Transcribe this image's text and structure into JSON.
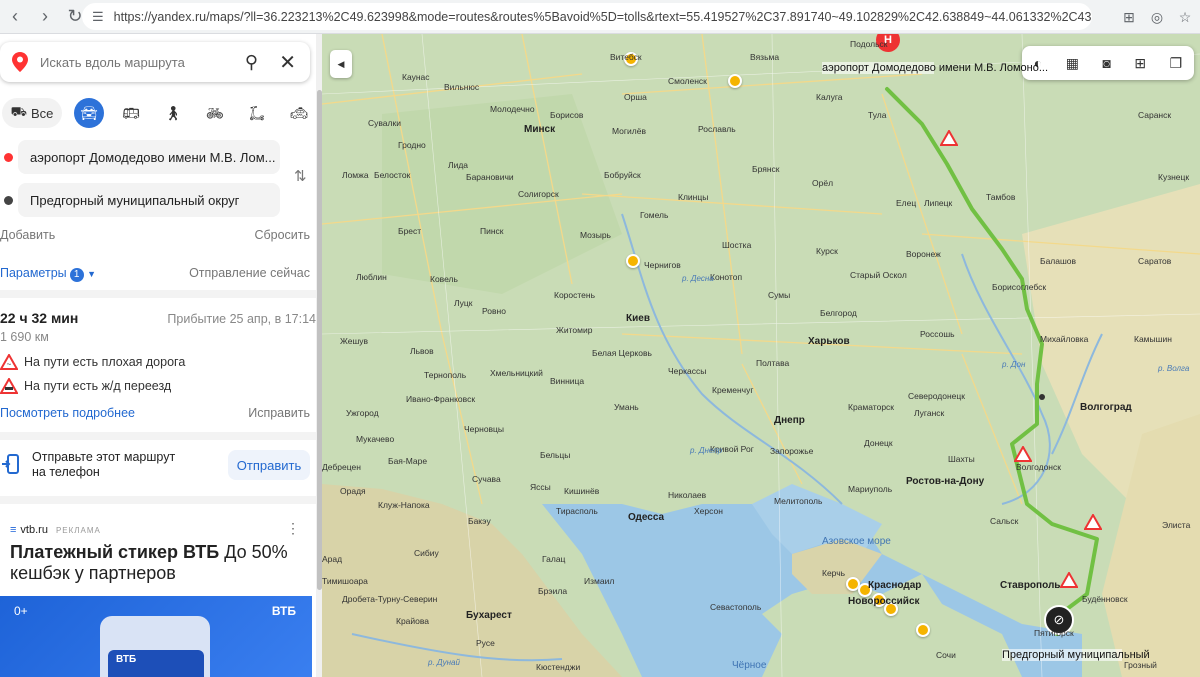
{
  "browser": {
    "url": "https://yandex.ru/maps/?ll=36.223213%2C49.623998&mode=routes&routes%5Bavoid%5D=tolls&rtext=55.419527%2C37.891740~49.102829%2C42.638849~44.061332%2C43.15..."
  },
  "search": {
    "placeholder": "Искать вдоль маршрута"
  },
  "modes": {
    "all_label": "Все"
  },
  "route": {
    "from": "аэропорт Домодедово имени М.В. Лом...",
    "to": "Предгорный муниципальный округ",
    "add_label": "Добавить",
    "reset_label": "Сбросить",
    "params_label": "Параметры",
    "params_count": "1",
    "departure_label": "Отправление сейчас",
    "duration": "22 ч 32 мин",
    "arrival": "Прибытие 25 апр, в 17:14",
    "distance": "1 690 км",
    "warnings": [
      "На пути есть плохая дорога",
      "На пути есть ж/д переезд"
    ],
    "details_label": "Посмотреть подробнее",
    "edit_label": "Исправить"
  },
  "send": {
    "text": "Отправьте этот маршрут на телефон",
    "button_label": "Отправить"
  },
  "ad": {
    "source": "vtb.ru",
    "tag": "РЕКЛАМА",
    "title_bold": "Платежный стикер ВТБ",
    "title_rest": " До 50% кешбэк у партнеров",
    "banner_left": "0+",
    "banner_brand": "ВТБ",
    "card_text": "ВТБ"
  },
  "map": {
    "start_label": "аэропорт Домодедово имени М.В. Ломоно...",
    "end_label": "Предгорный муниципальный",
    "sea_label": "Азовское море",
    "start_marker": "H",
    "cities": [
      {
        "name": "Вязьма"
      },
      {
        "name": "Витебск"
      },
      {
        "name": "Смоленск"
      },
      {
        "name": "Калуга"
      },
      {
        "name": "Подольск"
      },
      {
        "name": "Каунас"
      },
      {
        "name": "Вильнюс"
      },
      {
        "name": "Орша"
      },
      {
        "name": "Молодечно"
      },
      {
        "name": "Борисов"
      },
      {
        "name": "Минск"
      },
      {
        "name": "Могилёв"
      },
      {
        "name": "Рославль"
      },
      {
        "name": "Тула"
      },
      {
        "name": "Саранск"
      },
      {
        "name": "Сувалки"
      },
      {
        "name": "Гродно"
      },
      {
        "name": "Брянск"
      },
      {
        "name": "Бобруйск"
      },
      {
        "name": "Лида"
      },
      {
        "name": "Ломжа"
      },
      {
        "name": "Белосток"
      },
      {
        "name": "Барановичи"
      },
      {
        "name": "Орёл"
      },
      {
        "name": "Кузнецк"
      },
      {
        "name": "Солигорск"
      },
      {
        "name": "Клинцы"
      },
      {
        "name": "Елец"
      },
      {
        "name": "Липецк"
      },
      {
        "name": "Тамбов"
      },
      {
        "name": "Брест"
      },
      {
        "name": "Пинск"
      },
      {
        "name": "Гомель"
      },
      {
        "name": "Мозырь"
      },
      {
        "name": "Шостка"
      },
      {
        "name": "Курск"
      },
      {
        "name": "Воронеж"
      },
      {
        "name": "Балашов"
      },
      {
        "name": "Саратов"
      },
      {
        "name": "Чернигов"
      },
      {
        "name": "Конотоп"
      },
      {
        "name": "Старый Оскол"
      },
      {
        "name": "Люблин"
      },
      {
        "name": "Ковель"
      },
      {
        "name": "Борисоглебск"
      },
      {
        "name": "Коростень"
      },
      {
        "name": "Сумы"
      },
      {
        "name": "Луцк"
      },
      {
        "name": "Ровно"
      },
      {
        "name": "Белгород"
      },
      {
        "name": "Житомир"
      },
      {
        "name": "Киев"
      },
      {
        "name": "Россошь"
      },
      {
        "name": "Михайловка"
      },
      {
        "name": "Камышин"
      },
      {
        "name": "Жешув"
      },
      {
        "name": "Львов"
      },
      {
        "name": "Белая Церковь"
      },
      {
        "name": "Харьков"
      },
      {
        "name": "Полтава"
      },
      {
        "name": "Тернополь"
      },
      {
        "name": "Хмельницкий"
      },
      {
        "name": "Черкассы"
      },
      {
        "name": "Винница"
      },
      {
        "name": "Кременчуг"
      },
      {
        "name": "Северодонецк"
      },
      {
        "name": "Ивано-Франковск"
      },
      {
        "name": "Умань"
      },
      {
        "name": "Краматорск"
      },
      {
        "name": "Луганск"
      },
      {
        "name": "Волгоград"
      },
      {
        "name": "Ужгород"
      },
      {
        "name": "Днепр"
      },
      {
        "name": "Мукачево"
      },
      {
        "name": "Черновцы"
      },
      {
        "name": "Кривой Рог"
      },
      {
        "name": "Запорожье"
      },
      {
        "name": "Донецк"
      },
      {
        "name": "Бая-Маре"
      },
      {
        "name": "Бельцы"
      },
      {
        "name": "Шахты"
      },
      {
        "name": "Волгодонск"
      },
      {
        "name": "Дебрецен"
      },
      {
        "name": "Сучава"
      },
      {
        "name": "Яссы"
      },
      {
        "name": "Мариуполь"
      },
      {
        "name": "Ростов-на-Дону"
      },
      {
        "name": "Орадя"
      },
      {
        "name": "Кишинёв"
      },
      {
        "name": "Николаев"
      },
      {
        "name": "Мелитополь"
      },
      {
        "name": "Клуж-Напока"
      },
      {
        "name": "Тирасполь"
      },
      {
        "name": "Одесса"
      },
      {
        "name": "Херсон"
      },
      {
        "name": "Сальск"
      },
      {
        "name": "Элиста"
      },
      {
        "name": "Бакэу"
      },
      {
        "name": "Сибиу"
      },
      {
        "name": "Галац"
      },
      {
        "name": "Керчь"
      },
      {
        "name": "Новороссийск"
      },
      {
        "name": "Краснодар"
      },
      {
        "name": "Ставрополь"
      },
      {
        "name": "Будённовск"
      },
      {
        "name": "Брэила"
      },
      {
        "name": "Измаил"
      },
      {
        "name": "Бухарест"
      },
      {
        "name": "Севастополь"
      },
      {
        "name": "Пятигорск"
      },
      {
        "name": "Крайова"
      },
      {
        "name": "Русе"
      },
      {
        "name": "Сочи"
      },
      {
        "name": "Грозный"
      },
      {
        "name": "Тимишоара"
      },
      {
        "name": "Арад"
      },
      {
        "name": "Дробета-Турну-Северин"
      },
      {
        "name": "Кюстенджи"
      }
    ],
    "water_labels": [
      "р. Десна",
      "р. Днепр",
      "р. Дон",
      "р. Дунай",
      "р. Волга"
    ],
    "sea_black": "Чёрное"
  }
}
